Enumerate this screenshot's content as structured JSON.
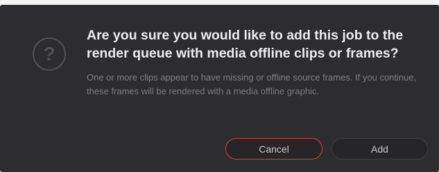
{
  "dialog": {
    "icon": "question-mark-icon",
    "icon_glyph": "?",
    "title": "Are you sure you would like to add this job to the render queue with media offline clips or frames?",
    "message": "One or more clips appear to have missing or offline source frames. If you continue, these frames will be rendered with a media offline graphic.",
    "buttons": {
      "cancel_label": "Cancel",
      "add_label": "Add"
    }
  },
  "colors": {
    "dialog_background": "#2d2d2f",
    "title_text": "#ececec",
    "message_text": "#7d7d80",
    "cancel_border": "#d8413a"
  }
}
